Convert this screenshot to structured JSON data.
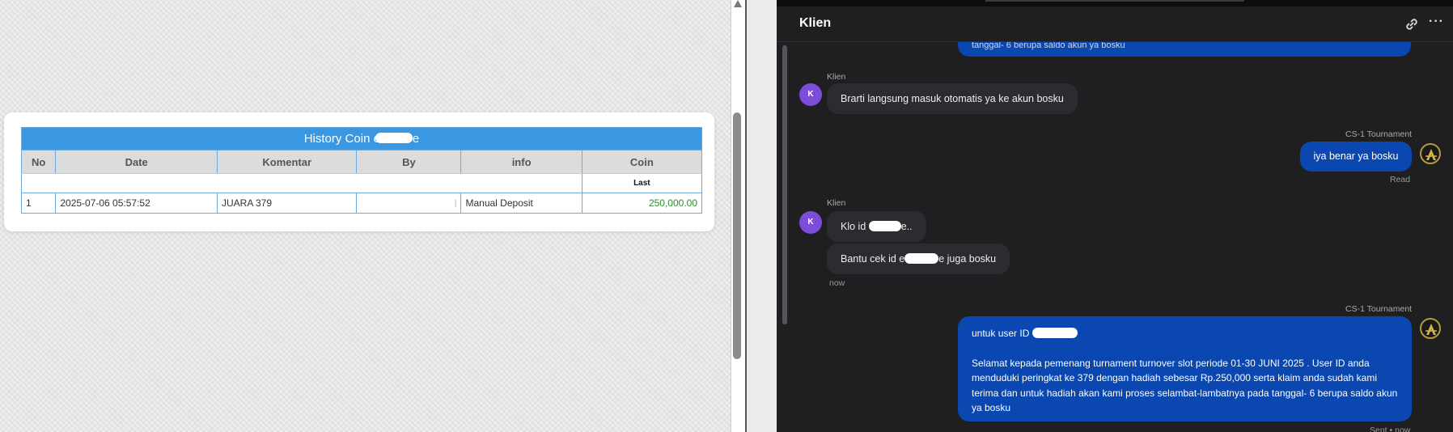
{
  "history": {
    "title_prefix": "History Coin e",
    "title_suffix": "e",
    "columns": [
      "No",
      "Date",
      "Komentar",
      "By",
      "info",
      "Coin"
    ],
    "sub_header": "Last",
    "rows": [
      {
        "no": "1",
        "date": "2025-07-06 05:57:52",
        "komentar": "JUARA 379",
        "by": "|",
        "info": "Manual Deposit",
        "coin": "250,000.00"
      }
    ]
  },
  "chat": {
    "title": "Klien",
    "top_partial_text": "tanggal- 6 berupa saldo akun ya bosku",
    "messages": [
      {
        "sender": "Klien",
        "avatar": "K",
        "text": "Brarti langsung masuk otomatis ya ke akun bosku"
      },
      {
        "sender": "CS-1 Tournament",
        "text": "iya benar ya bosku",
        "status": "Read"
      },
      {
        "sender": "Klien",
        "avatar": "K",
        "text_a_prefix": "Klo id ",
        "text_a_suffix": "e..",
        "text_b_prefix": "Bantu cek id e",
        "text_b_suffix": "e juga bosku",
        "time": "now"
      },
      {
        "sender": "CS-1 Tournament",
        "line1_prefix": "untuk user ID ",
        "paragraph": "Selamat kepada pemenang turnament turnover slot periode 01-30 JUNI 2025 . User ID anda menduduki peringkat ke 379 dengan hadiah sebesar Rp.250,000 serta klaim anda sudah kami terima dan untuk hadiah akan kami proses selambat-lambatnya pada tanggal- 6 berupa saldo akun ya bosku",
        "status": "Sent • now"
      }
    ]
  },
  "icons": {
    "link": "link-icon",
    "more": "more-icon",
    "scroll": "scroll-up-arrow-icon"
  },
  "colors": {
    "table_header": "#3a98e2",
    "coin_green": "#2e8b2e",
    "bubble_out": "#0b47b0",
    "bubble_in": "#2c2c30",
    "avatar_klien": "#7c4ddb"
  }
}
